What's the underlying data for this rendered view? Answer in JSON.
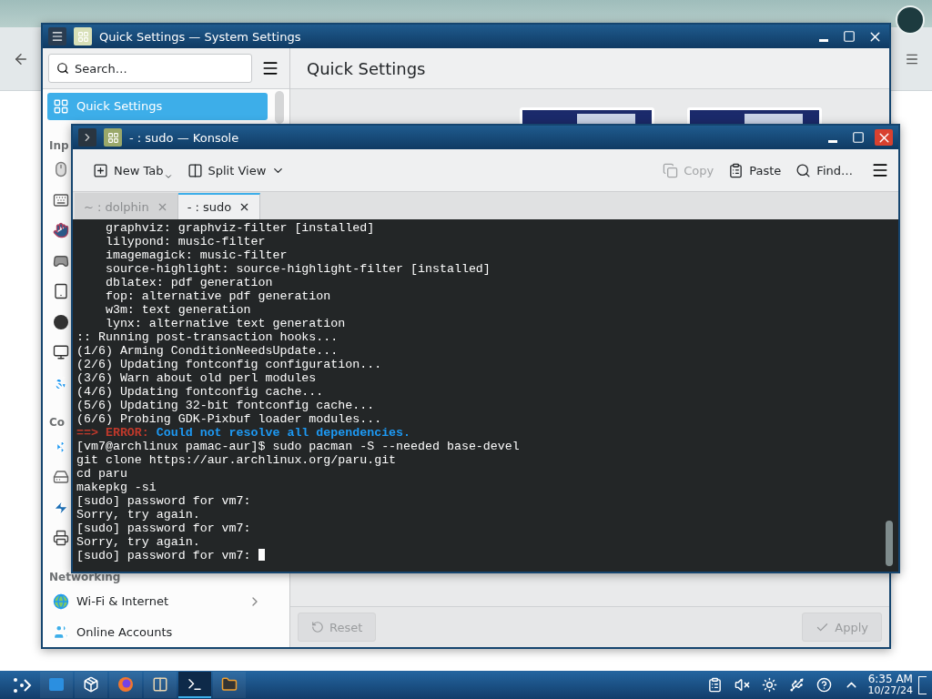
{
  "settings_window": {
    "title": "Quick Settings — System Settings",
    "search": {
      "placeholder": "Search…"
    },
    "sidebar": [
      {
        "kind": "quick-settings",
        "label": "Quick Settings",
        "selected": true
      },
      {
        "kind": "header",
        "label": "Inp"
      },
      {
        "kind": "mouse",
        "selected": false
      },
      {
        "kind": "keyboard",
        "selected": false
      },
      {
        "kind": "touch",
        "selected": false
      },
      {
        "kind": "gamepad",
        "selected": false
      },
      {
        "kind": "tablet",
        "selected": false
      },
      {
        "kind": "ball",
        "selected": false
      },
      {
        "kind": "monitor",
        "selected": false
      },
      {
        "kind": "accessibility",
        "selected": false
      },
      {
        "kind": "header",
        "label": "Co"
      },
      {
        "kind": "bluetooth",
        "selected": false
      },
      {
        "kind": "drive",
        "selected": false
      },
      {
        "kind": "thunderbolt",
        "selected": false
      },
      {
        "kind": "printer",
        "selected": false
      },
      {
        "kind": "header",
        "label": "Networking"
      },
      {
        "kind": "wifi",
        "label": "Wi-Fi & Internet",
        "selected": false,
        "expandable": true
      },
      {
        "kind": "accounts",
        "label": "Online Accounts",
        "selected": false
      }
    ],
    "page_title": "Quick Settings",
    "buttons": [
      {
        "kind": "reset",
        "label": "Reset",
        "disabled": true
      },
      {
        "kind": "apply",
        "label": "Apply",
        "disabled": true
      }
    ]
  },
  "konsole": {
    "title": "- : sudo — Konsole",
    "toolbar": [
      {
        "kind": "new-tab",
        "label": "New Tab",
        "disabled": false
      },
      {
        "kind": "split",
        "label": "Split View",
        "disabled": false
      },
      {
        "kind": "copy",
        "label": "Copy",
        "disabled": true
      },
      {
        "kind": "paste",
        "label": "Paste",
        "disabled": false
      },
      {
        "kind": "find",
        "label": "Find…",
        "disabled": false
      }
    ],
    "tabs": [
      {
        "label": "~ : dolphin",
        "selected": false
      },
      {
        "label": "- : sudo",
        "selected": true
      }
    ],
    "lines": [
      {
        "kind": "text",
        "text": "    graphviz: graphviz-filter [installed]"
      },
      {
        "kind": "text",
        "text": "    lilypond: music-filter"
      },
      {
        "kind": "text",
        "text": "    imagemagick: music-filter"
      },
      {
        "kind": "text",
        "text": "    source-highlight: source-highlight-filter [installed]"
      },
      {
        "kind": "text",
        "text": "    dblatex: pdf generation"
      },
      {
        "kind": "text",
        "text": "    fop: alternative pdf generation"
      },
      {
        "kind": "text",
        "text": "    w3m: text generation"
      },
      {
        "kind": "text",
        "text": "    lynx: alternative text generation"
      },
      {
        "kind": "text",
        "text": ":: Running post-transaction hooks..."
      },
      {
        "kind": "text",
        "text": "(1/6) Arming ConditionNeedsUpdate..."
      },
      {
        "kind": "text",
        "text": "(2/6) Updating fontconfig configuration..."
      },
      {
        "kind": "text",
        "text": "(3/6) Warn about old perl modules"
      },
      {
        "kind": "text",
        "text": "(4/6) Updating fontconfig cache..."
      },
      {
        "kind": "text",
        "text": "(5/6) Updating 32-bit fontconfig cache..."
      },
      {
        "kind": "text",
        "text": "(6/6) Probing GDK-Pixbuf loader modules..."
      },
      {
        "kind": "error",
        "label": "==> ERROR:",
        "text": "Could not resolve all dependencies."
      },
      {
        "kind": "text",
        "text": "[vm7@archlinux pamac-aur]$ sudo pacman -S --needed base-devel"
      },
      {
        "kind": "text",
        "text": "git clone https://aur.archlinux.org/paru.git"
      },
      {
        "kind": "text",
        "text": "cd paru"
      },
      {
        "kind": "text",
        "text": "makepkg -si"
      },
      {
        "kind": "text",
        "text": "[sudo] password for vm7:"
      },
      {
        "kind": "text",
        "text": "Sorry, try again."
      },
      {
        "kind": "text",
        "text": "[sudo] password for vm7:"
      },
      {
        "kind": "text",
        "text": "Sorry, try again."
      },
      {
        "kind": "text",
        "text": "[sudo] password for vm7: "
      }
    ],
    "cursor": true
  },
  "taskbar": {
    "tasks": [
      {
        "kind": "desktop",
        "selected": false
      },
      {
        "kind": "installer",
        "selected": false
      },
      {
        "kind": "browser",
        "selected": false
      },
      {
        "kind": "library",
        "selected": false
      },
      {
        "kind": "konsole",
        "selected": true
      },
      {
        "kind": "terminal",
        "selected": false
      }
    ],
    "tray": [
      {
        "kind": "clipboard"
      },
      {
        "kind": "muted"
      },
      {
        "kind": "brightness"
      },
      {
        "kind": "usb"
      },
      {
        "kind": "help"
      },
      {
        "kind": "expand"
      }
    ],
    "time": "6:35 AM",
    "date": "10/27/24"
  }
}
